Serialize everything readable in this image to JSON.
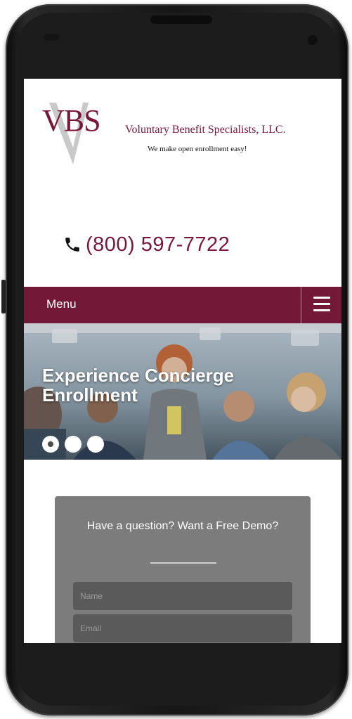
{
  "brand": {
    "logo_text": "VBS",
    "company_name": "Voluntary Benefit Specialists, LLC.",
    "tagline": "We make open enrollment easy!"
  },
  "contact": {
    "icon": "phone-icon",
    "phone_number": "(800) 597-7722"
  },
  "nav": {
    "menu_label": "Menu",
    "menu_icon": "hamburger-icon"
  },
  "hero": {
    "title": "Experience Concierge Enrollment",
    "slides": 3,
    "active_slide": 1
  },
  "form": {
    "title": "Have a question? Want a Free Demo?",
    "name_placeholder": "Name",
    "email_placeholder": "Email"
  },
  "colors": {
    "brand": "#741837",
    "form_bg": "#7c7c7c",
    "field_bg": "#5a5a5a"
  }
}
